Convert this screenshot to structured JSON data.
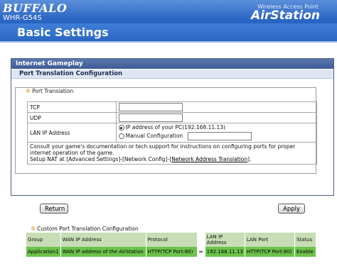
{
  "header": {
    "brand": "BUFFALO",
    "model": "WHR-G54S",
    "product_line": "Wireless Access Point",
    "product_name": "AirStation",
    "page_title": "Basic Settings"
  },
  "section": {
    "title": "Internet Gameplay",
    "subtitle": "Port Translation Configuration"
  },
  "port_translation": {
    "legend": "Port Translation",
    "tcp_label": "TCP",
    "tcp_value": "",
    "udp_label": "UDP",
    "udp_value": "",
    "lan_ip_label": "LAN IP Address",
    "option_pc": "IP address of your PC(192.168.11.13)",
    "option_manual": "Manual Configuration",
    "manual_value": "",
    "note_line1": "Consult your game's documentation or tech support for instructions on configuring ports for proper internet operation of the game.",
    "note_prefix": "Setup NAT at [Advanced Settings]-[Network Config]-[",
    "note_link": "Network Address Translation",
    "note_suffix": "]."
  },
  "buttons": {
    "return": "Return",
    "apply": "Apply"
  },
  "custom": {
    "legend": "Custom Port Translation Configuration",
    "headers": [
      "Group",
      "WAN IP Address",
      "Protocol",
      "LAN IP Address",
      "LAN Port",
      "Status"
    ],
    "arrow": "⇔",
    "rows": [
      [
        "Application1",
        "WAN IP address of the AirStation",
        "HTTP(TCP Port:80)",
        "192.168.11.13",
        "HTTP(TCP Port:80)",
        "Enable"
      ]
    ]
  },
  "colors": {
    "header_blue": "#2c67c4",
    "section_blue": "#3e5a92",
    "row_green": "#6cc24a",
    "header_green": "#c6ddb5"
  }
}
